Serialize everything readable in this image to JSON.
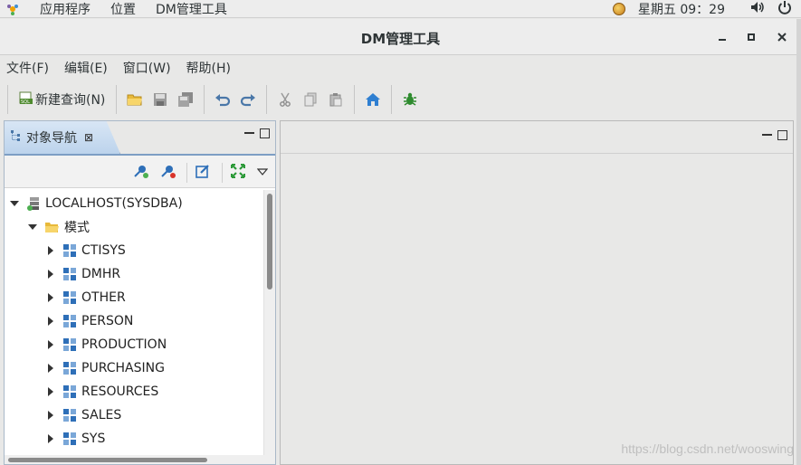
{
  "topbar": {
    "menus": [
      "应用程序",
      "位置",
      "DM管理工具"
    ],
    "clock": "星期五 09：29",
    "icons": [
      "app-logo-icon",
      "weather-icon",
      "volume-icon",
      "power-icon"
    ]
  },
  "window": {
    "title": "DM管理工具",
    "controls": [
      "minimize-icon",
      "maximize-icon",
      "close-icon"
    ]
  },
  "menubar": [
    "文件(F)",
    "编辑(E)",
    "窗口(W)",
    "帮助(H)"
  ],
  "toolbar": {
    "new_query_label": "新建查询(N)",
    "icons": [
      "sql-icon",
      "open-folder-icon",
      "save-icon",
      "save-all-icon",
      "undo-icon",
      "redo-icon",
      "cut-icon",
      "copy-icon",
      "paste-icon",
      "home-icon",
      "debug-icon"
    ]
  },
  "navigator": {
    "tab_label": "对象导航",
    "tab_close": "⊠",
    "tool_icons": [
      "connect-icon",
      "disconnect-icon",
      "edit-icon",
      "expand-icon",
      "dropdown-icon"
    ],
    "root": "LOCALHOST(SYSDBA)",
    "folder": "模式",
    "schemas": [
      "CTISYS",
      "DMHR",
      "OTHER",
      "PERSON",
      "PRODUCTION",
      "PURCHASING",
      "RESOURCES",
      "SALES",
      "SYS"
    ]
  },
  "watermark": "https://blog.csdn.net/wooswing"
}
